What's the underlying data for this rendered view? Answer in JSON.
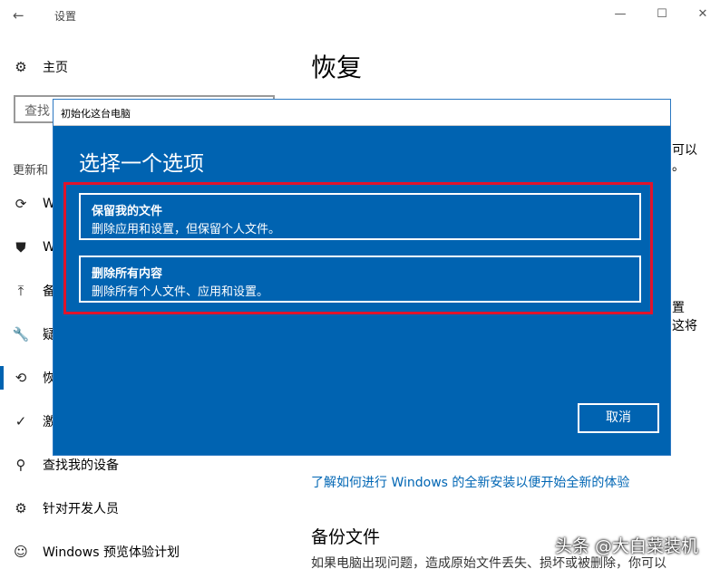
{
  "window": {
    "title": "设置",
    "back_icon": "←",
    "minimize_icon": "—",
    "maximize_icon": "☐",
    "close_icon": "✕"
  },
  "sidebar": {
    "home_label": "主页",
    "search_placeholder": "查找",
    "section_heading": "更新和",
    "items": [
      {
        "icon": "sync-icon",
        "glyph": "⟳",
        "label": "W"
      },
      {
        "icon": "shield-icon",
        "glyph": "⛊",
        "label": "W"
      },
      {
        "icon": "backup-icon",
        "glyph": "⤒",
        "label": "备"
      },
      {
        "icon": "wrench-icon",
        "glyph": "🔧",
        "label": "疑"
      },
      {
        "icon": "history-icon",
        "glyph": "⟲",
        "label": "恢"
      },
      {
        "icon": "check-circle-icon",
        "glyph": "✓",
        "label": "激"
      },
      {
        "icon": "person-icon",
        "glyph": "⚲",
        "label": "查找我的设备"
      },
      {
        "icon": "developer-icon",
        "glyph": "⚙",
        "label": "针对开发人员"
      },
      {
        "icon": "insider-icon",
        "glyph": "☺",
        "label": "Windows 预览体验计划"
      }
    ]
  },
  "main": {
    "title": "恢复",
    "peek_texts": [
      "可以",
      "。",
      "置",
      "这将"
    ],
    "link": "了解如何进行 Windows 的全新安装以便开始全新的体验",
    "backup_heading": "备份文件",
    "backup_desc": "如果电脑出现问题，造成原始文件丢失、损坏或被删除，你可以"
  },
  "dialog": {
    "title": "初始化这台电脑",
    "heading": "选择一个选项",
    "options": [
      {
        "title": "保留我的文件",
        "desc": "删除应用和设置，但保留个人文件。"
      },
      {
        "title": "删除所有内容",
        "desc": "删除所有个人文件、应用和设置。"
      }
    ],
    "cancel": "取消"
  },
  "watermark": "头条 @大白菜装机",
  "colors": {
    "dialog_blue": "#0063b1",
    "highlight_red": "#e0142c",
    "link_blue": "#0066b4"
  }
}
